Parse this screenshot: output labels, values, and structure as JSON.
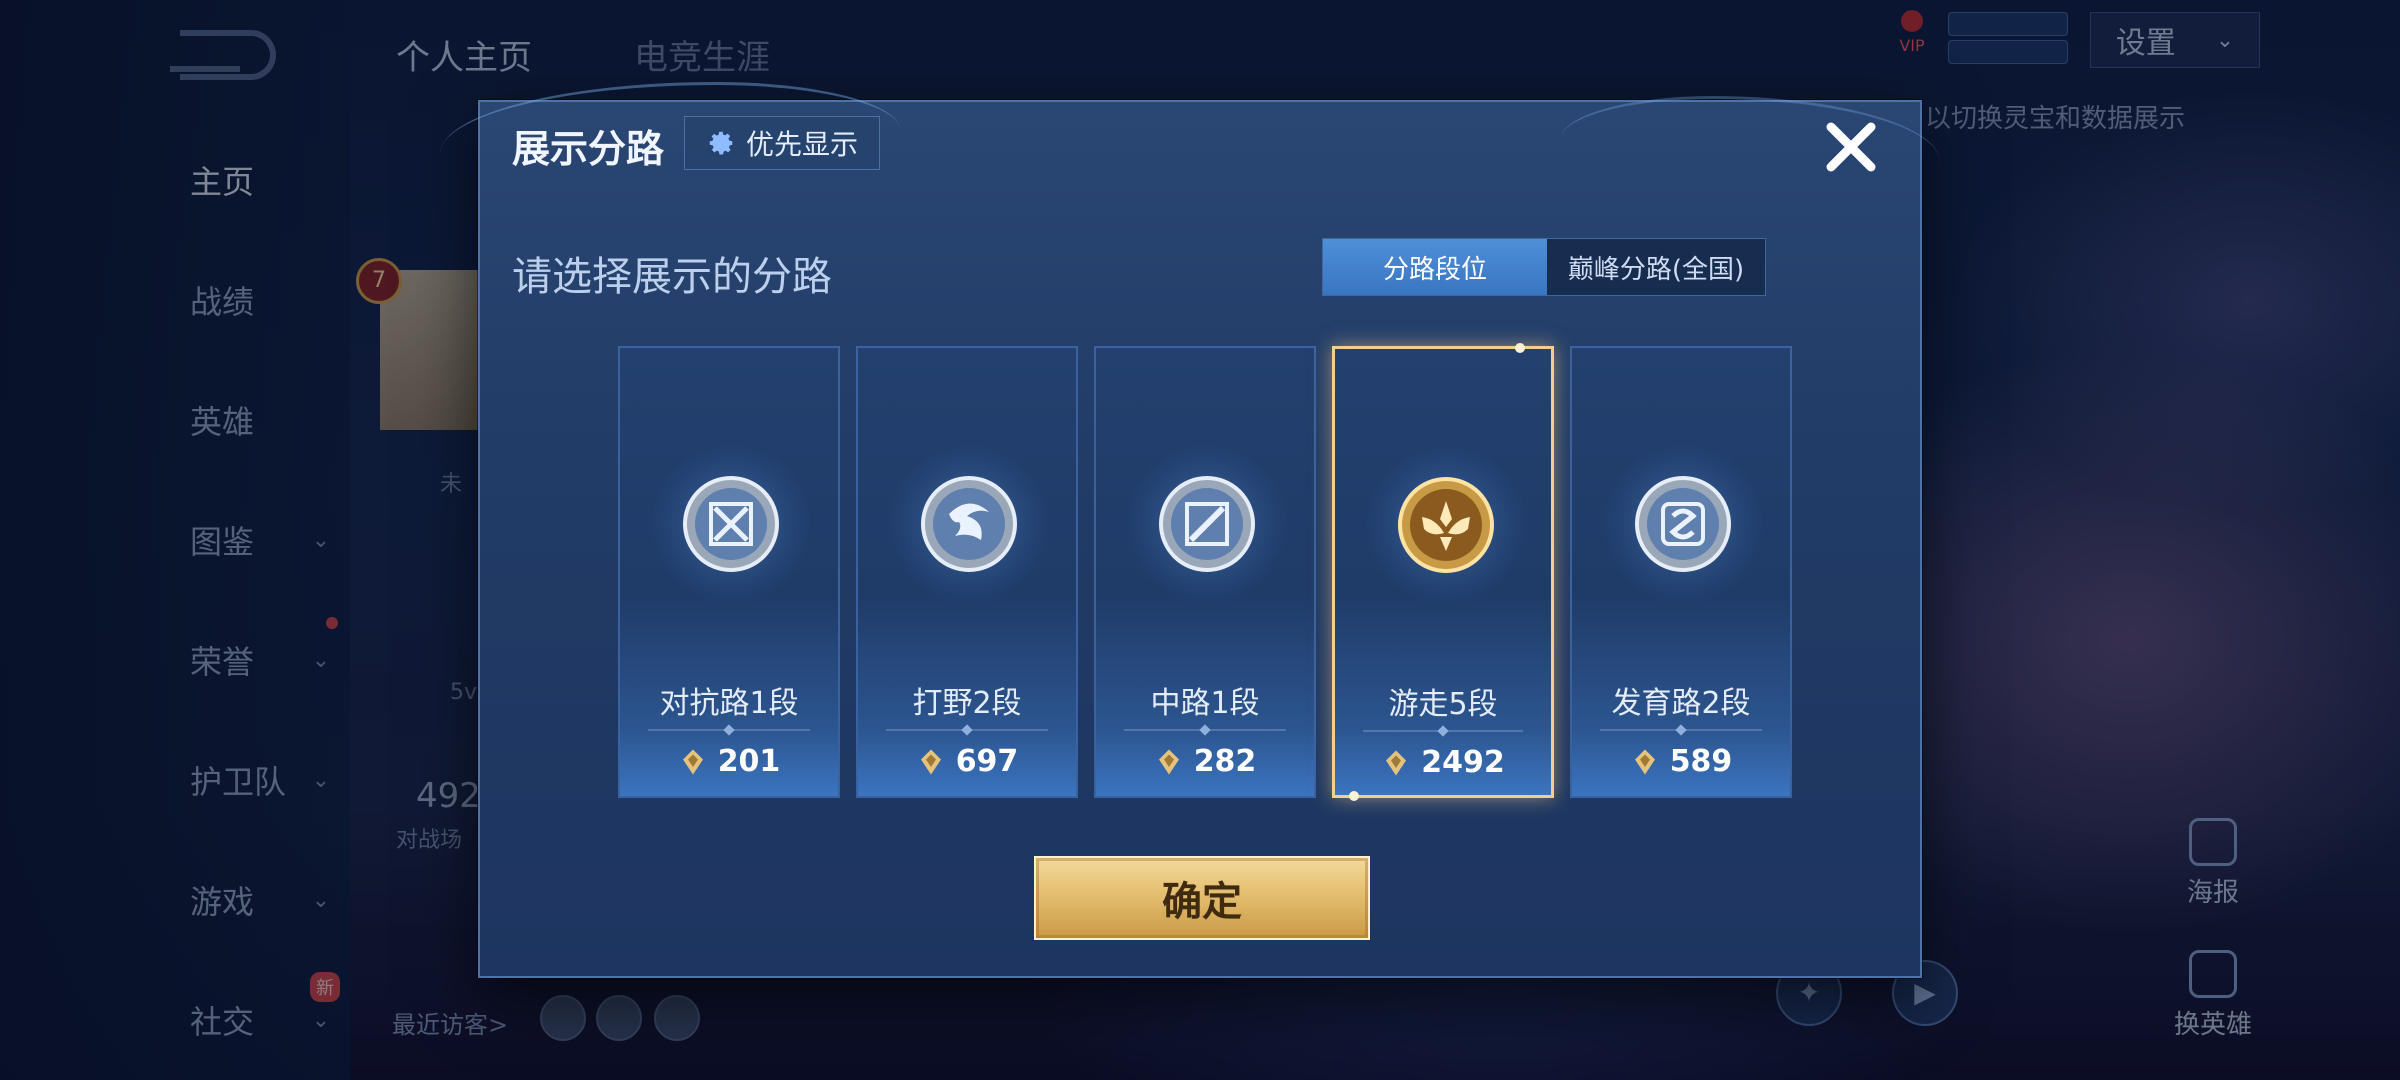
{
  "background": {
    "top_tabs": [
      "个人主页",
      "电竞生涯"
    ],
    "nav": [
      {
        "label": "主页",
        "active": true,
        "chevron": false
      },
      {
        "label": "战绩",
        "active": false,
        "chevron": false
      },
      {
        "label": "英雄",
        "active": false,
        "chevron": false
      },
      {
        "label": "图鉴",
        "active": false,
        "chevron": true
      },
      {
        "label": "荣誉",
        "active": false,
        "chevron": true
      },
      {
        "label": "护卫队",
        "active": false,
        "chevron": true
      },
      {
        "label": "游戏",
        "active": false,
        "chevron": true
      },
      {
        "label": "社交",
        "active": false,
        "chevron": true
      }
    ],
    "new_tag": "新",
    "vip_label": "VIP",
    "settings_label": "设置",
    "hint_text": "以切换灵宝和数据展示",
    "profile_level": "7",
    "profile_name_partial": "未",
    "stat_partial_1": "5v",
    "stat_number_partial": "492",
    "stat_label_partial": "对战场",
    "recent_visitors_label": "最近访客>",
    "poster_label": "海报",
    "change_hero_label": "换英雄"
  },
  "modal": {
    "title": "展示分路",
    "priority_button": "优先显示",
    "subtitle": "请选择展示的分路",
    "tabs": [
      "分路段位",
      "巅峰分路(全国)"
    ],
    "selected_tab": "分路段位",
    "lanes": [
      {
        "name": "对抗路1段",
        "score": "201",
        "emblem": "clash-lane-icon",
        "selected": false
      },
      {
        "name": "打野2段",
        "score": "697",
        "emblem": "jungle-icon",
        "selected": false
      },
      {
        "name": "中路1段",
        "score": "282",
        "emblem": "mid-lane-icon",
        "selected": false
      },
      {
        "name": "游走5段",
        "score": "2492",
        "emblem": "roam-icon",
        "selected": true
      },
      {
        "name": "发育路2段",
        "score": "589",
        "emblem": "farm-lane-icon",
        "selected": false
      }
    ],
    "confirm_button": "确定"
  },
  "colors": {
    "accent_blue": "#3a75c2",
    "gold": "#e2bb6c",
    "selected_border": "#f1d08c"
  }
}
